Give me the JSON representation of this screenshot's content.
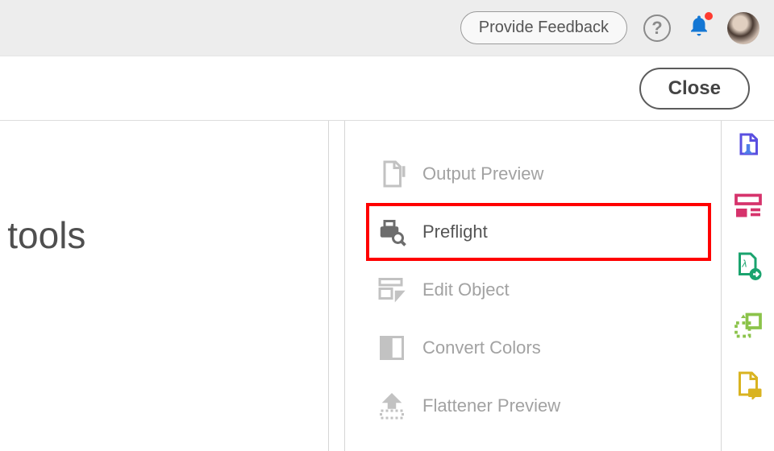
{
  "topbar": {
    "feedback_label": "Provide Feedback"
  },
  "secondbar": {
    "close_label": "Close"
  },
  "left": {
    "heading_fragment": "ore tools"
  },
  "tools": {
    "items": [
      {
        "label": "Output Preview"
      },
      {
        "label": "Preflight"
      },
      {
        "label": "Edit Object"
      },
      {
        "label": "Convert Colors"
      },
      {
        "label": "Flattener Preview"
      }
    ]
  }
}
